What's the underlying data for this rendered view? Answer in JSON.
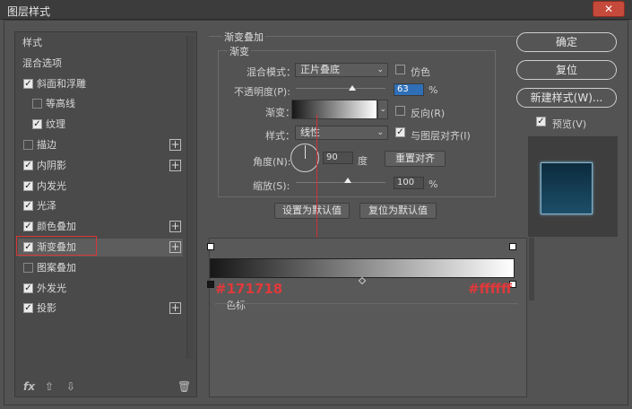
{
  "window": {
    "title": "图层样式",
    "close_glyph": "✕"
  },
  "sidebar": {
    "items": [
      {
        "label": "样式",
        "has_checkbox": false,
        "checked": false,
        "has_plus": false
      },
      {
        "label": "混合选项",
        "has_checkbox": false,
        "checked": false,
        "has_plus": false
      },
      {
        "label": "斜面和浮雕",
        "has_checkbox": true,
        "checked": true,
        "has_plus": false
      },
      {
        "label": "等高线",
        "has_checkbox": true,
        "checked": false,
        "has_plus": false,
        "indent": true
      },
      {
        "label": "纹理",
        "has_checkbox": true,
        "checked": true,
        "has_plus": false,
        "indent": true
      },
      {
        "label": "描边",
        "has_checkbox": true,
        "checked": false,
        "has_plus": true
      },
      {
        "label": "内阴影",
        "has_checkbox": true,
        "checked": true,
        "has_plus": true
      },
      {
        "label": "内发光",
        "has_checkbox": true,
        "checked": true,
        "has_plus": false
      },
      {
        "label": "光泽",
        "has_checkbox": true,
        "checked": true,
        "has_plus": false
      },
      {
        "label": "颜色叠加",
        "has_checkbox": true,
        "checked": true,
        "has_plus": true
      },
      {
        "label": "渐变叠加",
        "has_checkbox": true,
        "checked": true,
        "has_plus": true,
        "active": true
      },
      {
        "label": "图案叠加",
        "has_checkbox": true,
        "checked": false,
        "has_plus": false
      },
      {
        "label": "外发光",
        "has_checkbox": true,
        "checked": true,
        "has_plus": false
      },
      {
        "label": "投影",
        "has_checkbox": true,
        "checked": true,
        "has_plus": true
      }
    ],
    "bottom_icons": [
      "fx-icon",
      "arrow-up-icon",
      "arrow-down-icon",
      "trash-icon"
    ],
    "fx_label": "fx"
  },
  "gradient_overlay": {
    "section_title": "渐变叠加",
    "group_title": "渐变",
    "blend_mode_label": "混合模式：",
    "blend_mode_value": "正片叠底",
    "dither_label": "仿色",
    "opacity_label": "不透明度(P):",
    "opacity_value": "63",
    "opacity_unit": "%",
    "gradient_label": "渐变：",
    "reverse_label": "反向(R)",
    "style_label": "样式：",
    "style_value": "线性",
    "align_label": "与图层对齐(I)",
    "angle_label": "角度(N):",
    "angle_value": "90",
    "angle_unit": "度",
    "reset_align_label": "重置对齐",
    "scale_label": "缩放(S):",
    "scale_value": "100",
    "scale_unit": "%",
    "set_default_label": "设置为默认值",
    "reset_default_label": "复位为默认值",
    "opacity_level": 0.63,
    "scale_level": 1.0
  },
  "gradient_editor": {
    "left_color": "#171718",
    "right_color": "#ffffff",
    "left_label": "#171718",
    "right_label": "#ffffff",
    "stops_label": "色标"
  },
  "buttons": {
    "ok": "确定",
    "reset": "复位",
    "new_style": "新建样式(W)...",
    "preview_label": "预览(V)"
  }
}
